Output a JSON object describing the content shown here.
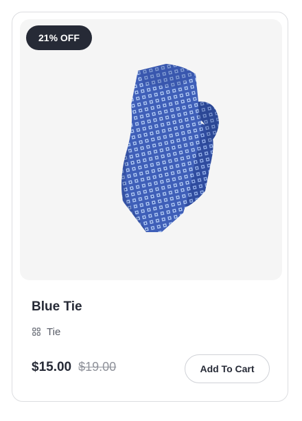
{
  "product": {
    "badge": "21% OFF",
    "name": "Blue Tie",
    "category": "Tie",
    "category_icon": "grid-icon",
    "price": "$15.00",
    "original_price": "$19.00",
    "add_to_cart_label": "Add To Cart"
  },
  "colors": {
    "badge_bg": "#262a36",
    "tie_blue": "#3f5fb8",
    "tie_pattern": "#a9c3f2",
    "image_bg": "#f5f5f5"
  }
}
